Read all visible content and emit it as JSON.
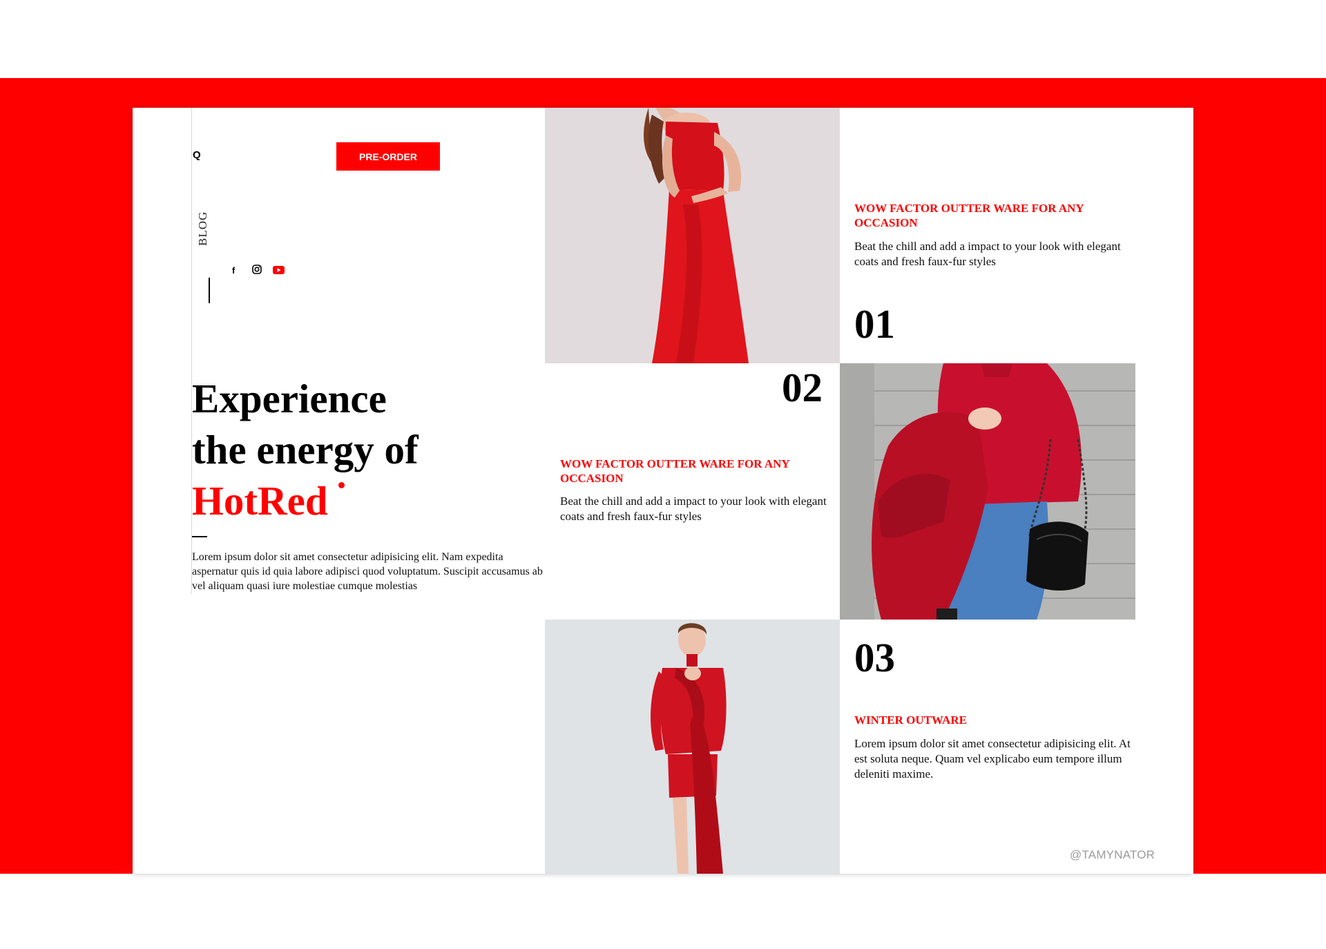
{
  "colors": {
    "accent": "#ff0000",
    "text": "#000000",
    "background": "#ffffff"
  },
  "header": {
    "search_icon_glyph": "Q",
    "preorder_label": "PRE-ORDER"
  },
  "sidebar": {
    "blog_label": "BLOG",
    "social_icons": [
      "facebook-icon",
      "instagram-icon",
      "youtube-icon"
    ],
    "facebook_glyph": "f"
  },
  "hero": {
    "title_line1": "Experience",
    "title_line2": "the energy of",
    "title_accent": "HotRed",
    "description": "Lorem ipsum dolor sit amet consectetur adipisicing elit. Nam expedita aspernatur quis id quia labore adipisci quod voluptatum. Suscipit accusamus ab vel aliquam quasi iure molestiae cumque molestias"
  },
  "features": [
    {
      "number": "01",
      "title": "WOW FACTOR OUTTER WARE FOR ANY OCCASION",
      "text": "Beat the chill and add a impact to your look with elegant coats and fresh faux-fur styles"
    },
    {
      "number": "02",
      "title": "WOW FACTOR OUTTER WARE FOR ANY OCCASION",
      "text": "Beat the chill and add a impact to your look with elegant coats and fresh faux-fur styles"
    },
    {
      "number": "03",
      "title": "WINTER OUTWARE",
      "text": "Lorem ipsum dolor sit amet consectetur adipisicing elit. At est soluta neque. Quam vel explicabo eum tempore illum deleniti maxime."
    }
  ],
  "photos": [
    "red-strapless-dress-photo",
    "red-sweater-coat-handbag-photo",
    "red-drape-dress-photo"
  ],
  "watermark": "@TAMYNATOR"
}
